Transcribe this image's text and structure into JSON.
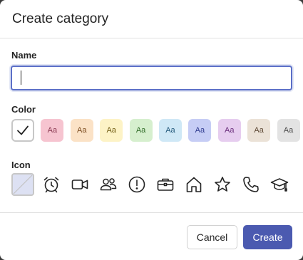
{
  "dialog": {
    "title": "Create category"
  },
  "name_section": {
    "label": "Name",
    "value": "",
    "placeholder": ""
  },
  "color_section": {
    "label": "Color",
    "selected": "none",
    "swatches": [
      {
        "name": "none",
        "text": "",
        "bg": "#ffffff",
        "fg": "#242424"
      },
      {
        "name": "red",
        "text": "Aa",
        "bg": "#f6c4d0",
        "fg": "#8a3a52"
      },
      {
        "name": "orange",
        "text": "Aa",
        "bg": "#fbe2c6",
        "fg": "#7a4a1e"
      },
      {
        "name": "yellow",
        "text": "Aa",
        "bg": "#fdf3c6",
        "fg": "#6f5b12"
      },
      {
        "name": "green",
        "text": "Aa",
        "bg": "#d6efce",
        "fg": "#2f6b27"
      },
      {
        "name": "teal",
        "text": "Aa",
        "bg": "#cfe8f6",
        "fg": "#22587a"
      },
      {
        "name": "blue",
        "text": "Aa",
        "bg": "#c6cdf5",
        "fg": "#2f3b8f"
      },
      {
        "name": "purple",
        "text": "Aa",
        "bg": "#e6cdef",
        "fg": "#6b2f7d"
      },
      {
        "name": "brown",
        "text": "Aa",
        "bg": "#ebe2d7",
        "fg": "#5e4a36"
      },
      {
        "name": "gray",
        "text": "Aa",
        "bg": "#e3e3e3",
        "fg": "#4a4a4a"
      }
    ]
  },
  "icon_section": {
    "label": "Icon",
    "selected": "none",
    "icons": [
      "none-icon",
      "alarm-clock-icon",
      "video-camera-icon",
      "people-icon",
      "alert-icon",
      "briefcase-icon",
      "home-icon",
      "star-icon",
      "phone-icon",
      "graduation-cap-icon"
    ]
  },
  "footer": {
    "cancel_label": "Cancel",
    "create_label": "Create"
  },
  "colors": {
    "accent": "#4b5ab0",
    "focus_border": "#5b6fc7"
  }
}
